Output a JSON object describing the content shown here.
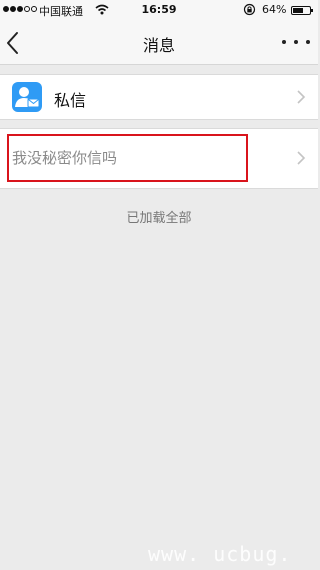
{
  "status_bar": {
    "carrier": "中国联通",
    "time": "16:59",
    "battery_percent": "64%",
    "battery_level": 0.64,
    "signal_filled": 3,
    "signal_total": 5
  },
  "nav": {
    "title": "消息",
    "back_icon": "chevron-left-icon",
    "more_icon": "more-dots-icon"
  },
  "list": {
    "private_message_label": "私信",
    "secret_label": "我没秘密你信吗",
    "loaded_all": "已加载全部"
  },
  "colors": {
    "accent_icon": "#2f9bf5",
    "highlight": "#d9141c"
  },
  "watermark": "www. ucbug. cc"
}
